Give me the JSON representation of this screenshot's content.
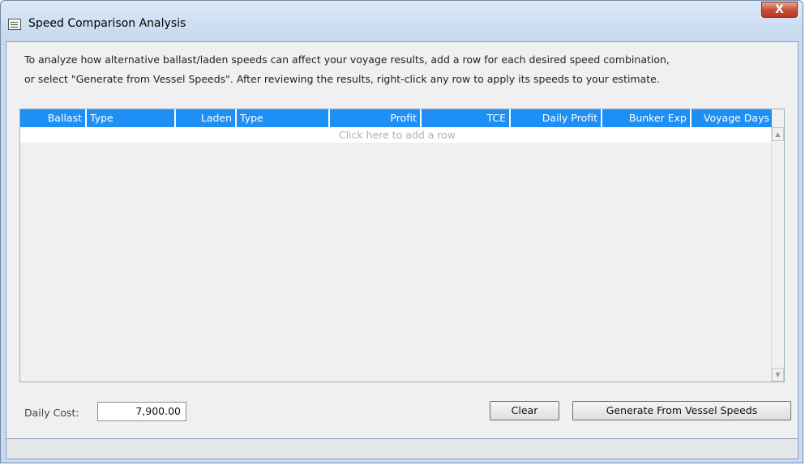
{
  "window": {
    "title": "Speed Comparison Analysis",
    "close_glyph": "X",
    "title_icon": "window-menu-icon"
  },
  "instructions": {
    "line1": "To analyze how alternative ballast/laden speeds can affect your voyage results, add a row for each desired speed combination,",
    "line2": "or select \"Generate from Vessel Speeds\". After reviewing the results, right-click any row to apply its speeds to your estimate."
  },
  "grid": {
    "columns": [
      {
        "label": "Ballast"
      },
      {
        "label": "Type"
      },
      {
        "label": "Laden"
      },
      {
        "label": "Type"
      },
      {
        "label": "Profit"
      },
      {
        "label": "TCE"
      },
      {
        "label": "Daily Profit"
      },
      {
        "label": "Bunker Exp"
      },
      {
        "label": "Voyage Days"
      }
    ],
    "add_row_text": "Click here to add a row",
    "header_color": "#1e8ff5"
  },
  "footer": {
    "daily_cost_label": "Daily Cost:",
    "daily_cost_value": "7,900.00",
    "clear_label": "Clear",
    "generate_label": "Generate From Vessel Speeds"
  }
}
